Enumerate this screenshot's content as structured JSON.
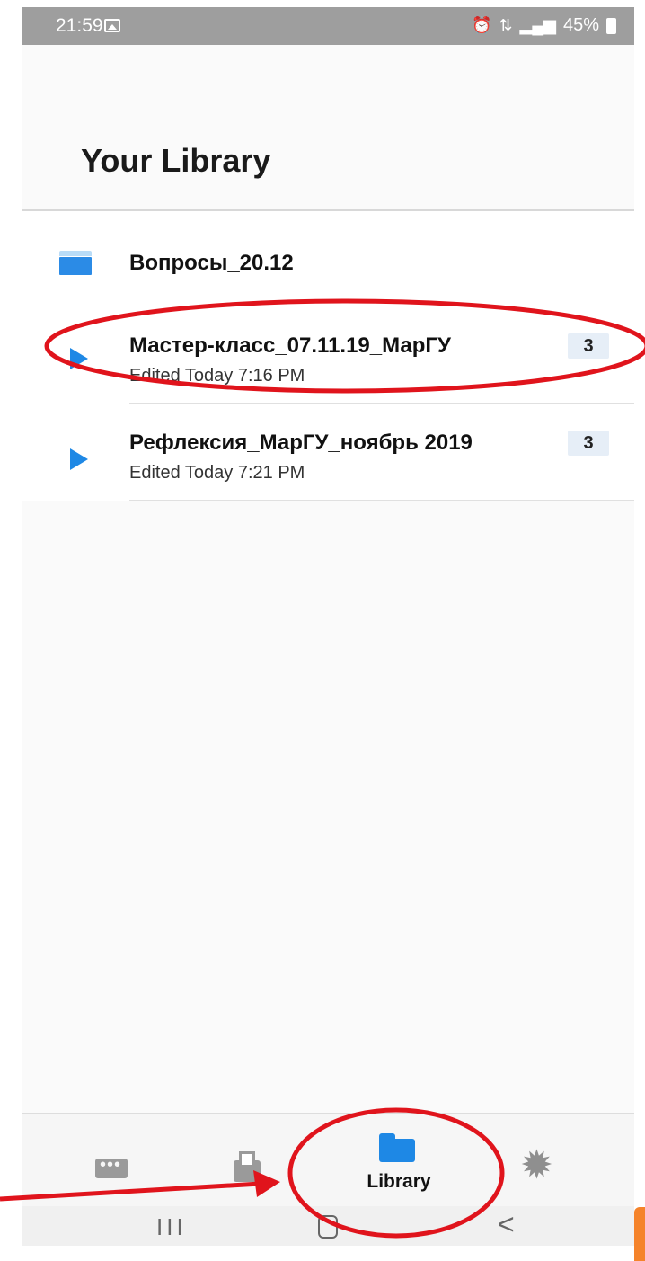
{
  "status_bar": {
    "time": "21:59",
    "battery": "45%",
    "icons": [
      "image-icon",
      "alarm-icon",
      "data-icon",
      "signal-icon",
      "battery-icon"
    ]
  },
  "header": {
    "title": "Your Library"
  },
  "library": {
    "folder": {
      "name": "Вопросы_20.12"
    },
    "items": [
      {
        "title": "Мастер-класс_07.11.19_МарГУ",
        "edited": "Edited Today 7:16 PM",
        "count": "3"
      },
      {
        "title": "Рефлексия_МарГУ_ноябрь 2019",
        "edited": "Edited Today 7:21 PM",
        "count": "3"
      }
    ]
  },
  "bottom_nav": {
    "active_label": "Library",
    "items": [
      "people-icon",
      "inbox-icon",
      "library-folder-icon",
      "gear-icon"
    ]
  },
  "system_nav": {
    "recent": "III",
    "back": "<"
  },
  "colors": {
    "accent": "#1e88e5",
    "annotation": "#e0141c",
    "status_bar": "#9e9e9e"
  }
}
